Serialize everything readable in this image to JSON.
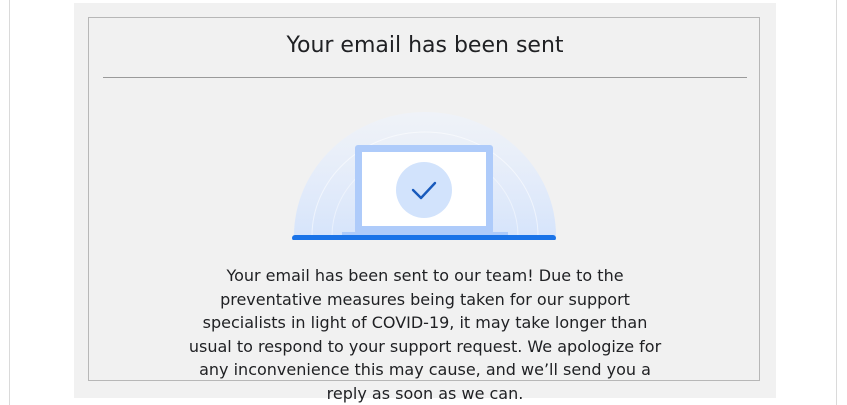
{
  "dialog": {
    "title": "Your email has been sent",
    "message": "Your email has been sent to our team! Due to the preventative measures being taken for our support specialists in light of COVID-19, it may take longer than usual to respond to your support request. We apologize for any inconvenience this may cause, and we’ll send you a reply as soon as we can."
  },
  "illustration": {
    "icon": "laptop-checkmark-icon",
    "colors": {
      "accent": "#1a73e8",
      "glow": "#dce8fb",
      "laptop_frame": "#aecbfa",
      "check_circle": "#d2e3fc",
      "check": "#185abc"
    }
  }
}
